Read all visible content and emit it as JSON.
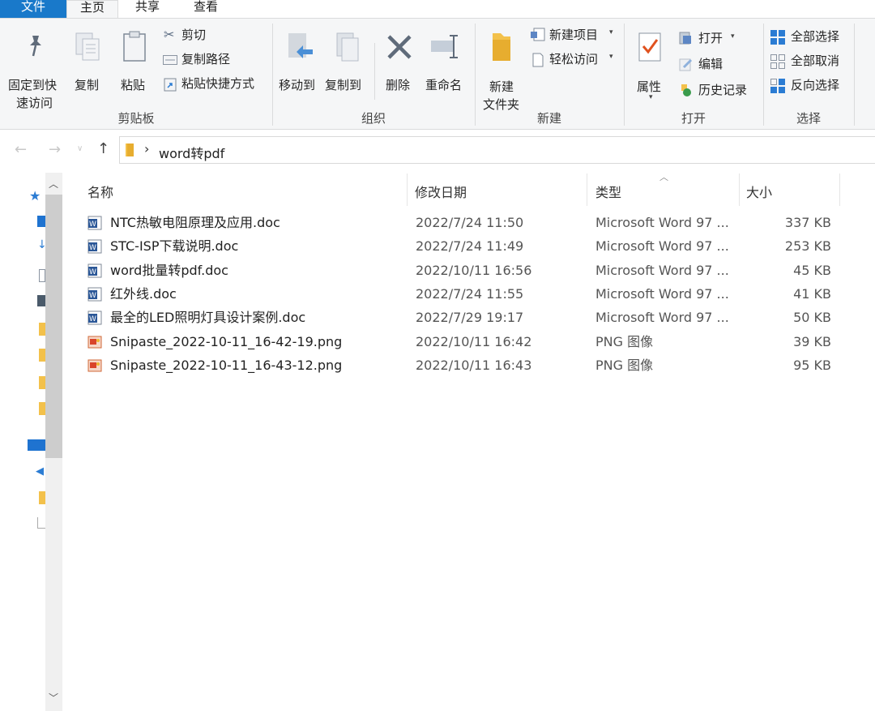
{
  "tabs": {
    "file": "文件",
    "home": "主页",
    "share": "共享",
    "view": "查看"
  },
  "ribbon": {
    "clipboard": {
      "pin_line1": "固定到快",
      "pin_line2": "速访问",
      "copy": "复制",
      "paste": "粘贴",
      "cut": "剪切",
      "copy_path": "复制路径",
      "paste_shortcut": "粘贴快捷方式",
      "group": "剪贴板"
    },
    "organize": {
      "move_to": "移动到",
      "copy_to": "复制到",
      "delete": "删除",
      "rename": "重命名",
      "group": "组织"
    },
    "new": {
      "new_folder_line1": "新建",
      "new_folder_line2": "文件夹",
      "new_item": "新建项目",
      "easy_access": "轻松访问",
      "group": "新建"
    },
    "open": {
      "properties": "属性",
      "open": "打开",
      "edit": "编辑",
      "history": "历史记录",
      "group": "打开"
    },
    "select": {
      "select_all": "全部选择",
      "select_none": "全部取消",
      "invert": "反向选择",
      "group": "选择"
    }
  },
  "nav": {
    "path": "word转pdf",
    "separator": "›"
  },
  "columns": {
    "name": "名称",
    "date": "修改日期",
    "type": "类型",
    "size": "大小"
  },
  "files": [
    {
      "name": "NTC热敏电阻原理及应用.doc",
      "date": "2022/7/24 11:50",
      "type": "Microsoft Word 97 ...",
      "size": "337 KB",
      "icon": "word-doc-icon"
    },
    {
      "name": "STC-ISP下载说明.doc",
      "date": "2022/7/24 11:49",
      "type": "Microsoft Word 97 ...",
      "size": "253 KB",
      "icon": "word-doc-icon"
    },
    {
      "name": "word批量转pdf.doc",
      "date": "2022/10/11 16:56",
      "type": "Microsoft Word 97 ...",
      "size": "45 KB",
      "icon": "word-doc-icon"
    },
    {
      "name": "红外线.doc",
      "date": "2022/7/24 11:55",
      "type": "Microsoft Word 97 ...",
      "size": "41 KB",
      "icon": "word-doc-icon"
    },
    {
      "name": "最全的LED照明灯具设计案例.doc",
      "date": "2022/7/29 19:17",
      "type": "Microsoft Word 97 ...",
      "size": "50 KB",
      "icon": "word-doc-icon"
    },
    {
      "name": "Snipaste_2022-10-11_16-42-19.png",
      "date": "2022/10/11 16:42",
      "type": "PNG 图像",
      "size": "39 KB",
      "icon": "png-image-icon"
    },
    {
      "name": "Snipaste_2022-10-11_16-43-12.png",
      "date": "2022/10/11 16:43",
      "type": "PNG 图像",
      "size": "95 KB",
      "icon": "png-image-icon"
    }
  ],
  "colors": {
    "file_tab": "#1979ca",
    "ribbon_bg": "#f5f6f7",
    "accent_blue": "#2b7cd3",
    "folder_yellow": "#f3c14b"
  }
}
